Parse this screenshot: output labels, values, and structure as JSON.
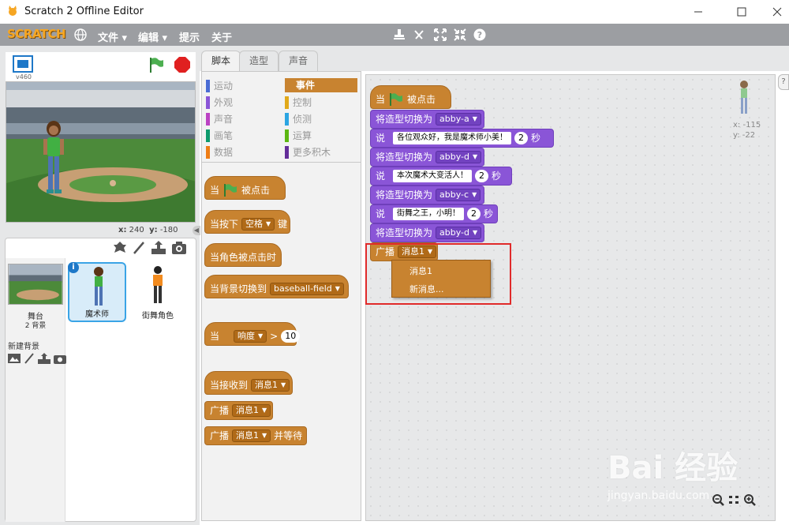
{
  "window": {
    "title": "Scratch 2 Offline Editor"
  },
  "menubar": {
    "logo": "SCRATCH",
    "items": [
      "文件",
      "编辑",
      "提示",
      "关于"
    ]
  },
  "stage": {
    "version": "v460",
    "x_label": "x:",
    "x_value": "240",
    "y_label": "y:",
    "y_value": "-180"
  },
  "sprites_panel": {
    "stage_label": "舞台",
    "stage_bg_count": "2 背景",
    "new_backdrop_label": "新建背景",
    "sprites": [
      {
        "name": "魔术师",
        "selected": true
      },
      {
        "name": "街舞角色",
        "selected": false
      }
    ],
    "info_badge": "i"
  },
  "tabs": [
    "脚本",
    "造型",
    "声音"
  ],
  "categories": {
    "left": [
      "运动",
      "外观",
      "声音",
      "画笔",
      "数据"
    ],
    "right": [
      "事件",
      "控制",
      "侦测",
      "运算",
      "更多积木"
    ],
    "selected": "事件",
    "colors": {
      "运动": "#4a6cd4",
      "外观": "#8a55d7",
      "声音": "#bb42c3",
      "画笔": "#0e9a6c",
      "数据": "#ee7d16",
      "事件": "#c88330",
      "控制": "#e1a91a",
      "侦测": "#2ca5e2",
      "运算": "#5cb712",
      "更多积木": "#632d99"
    }
  },
  "palette_blocks": {
    "when_flag": {
      "pre": "当",
      "post": "被点击"
    },
    "when_key": {
      "pre": "当按下",
      "key": "空格",
      "post": "键"
    },
    "when_sprite_clicked": "当角色被点击时",
    "when_backdrop": {
      "pre": "当背景切换到",
      "value": "baseball-field"
    },
    "when_sensor": {
      "pre": "当",
      "sensor": "响度",
      "op": ">",
      "value": "10"
    },
    "when_receive": {
      "pre": "当接收到",
      "msg": "消息1"
    },
    "broadcast": {
      "pre": "广播",
      "msg": "消息1"
    },
    "broadcast_wait": {
      "pre": "广播",
      "msg": "消息1",
      "post": "并等待"
    }
  },
  "script": {
    "hat": {
      "pre": "当",
      "post": "被点击"
    },
    "switch_label": "将造型切换为",
    "say_label": "说",
    "sec_label": "秒",
    "steps": [
      {
        "type": "switch",
        "value": "abby-a"
      },
      {
        "type": "say",
        "text": "各位观众好，我是魔术师小美！",
        "secs": "2"
      },
      {
        "type": "switch",
        "value": "abby-d"
      },
      {
        "type": "say",
        "text": "本次魔术大变活人！",
        "secs": "2"
      },
      {
        "type": "switch",
        "value": "abby-c"
      },
      {
        "type": "say",
        "text": "街舞之王，小明！",
        "secs": "2"
      },
      {
        "type": "switch",
        "value": "abby-d"
      }
    ],
    "broadcast": {
      "pre": "广播",
      "msg": "消息1"
    },
    "dropdown_menu": [
      "消息1",
      "新消息..."
    ]
  },
  "script_sprite": {
    "x_label": "x:",
    "x_value": "-115",
    "y_label": "y:",
    "y_value": "-22"
  },
  "watermark": {
    "main": "Bai 经验",
    "sub": "jingyan.baidu.com"
  }
}
